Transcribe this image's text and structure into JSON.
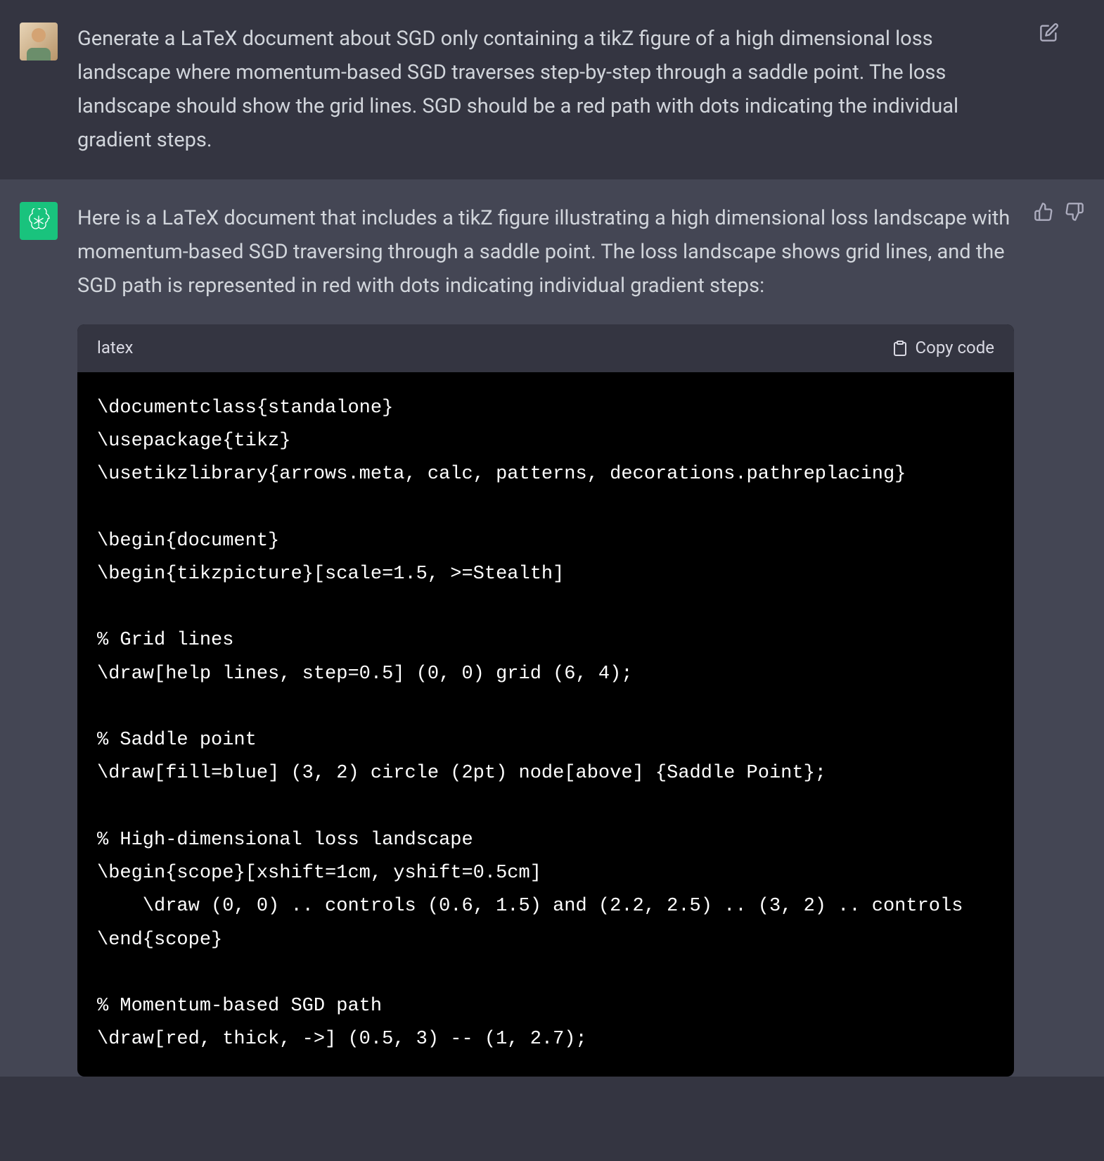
{
  "user_message": {
    "text": "Generate a LaTeX document about SGD only containing a tikZ figure of a high dimensional loss landscape where momentum-based SGD traverses step-by-step through a saddle point. The loss landscape should show the grid lines. SGD should be a red path with dots indicating the individual gradient steps."
  },
  "assistant_message": {
    "intro_text": "Here is a LaTeX document that includes a tikZ figure illustrating a high dimensional loss landscape with momentum-based SGD traversing through a saddle point. The loss landscape shows grid lines, and the SGD path is represented in red with dots indicating individual gradient steps:"
  },
  "code_block": {
    "language": "latex",
    "copy_label": "Copy code",
    "code": "\\documentclass{standalone}\n\\usepackage{tikz}\n\\usetikzlibrary{arrows.meta, calc, patterns, decorations.pathreplacing}\n\n\\begin{document}\n\\begin{tikzpicture}[scale=1.5, >=Stealth]\n\n% Grid lines\n\\draw[help lines, step=0.5] (0, 0) grid (6, 4);\n\n% Saddle point\n\\draw[fill=blue] (3, 2) circle (2pt) node[above] {Saddle Point};\n\n% High-dimensional loss landscape\n\\begin{scope}[xshift=1cm, yshift=0.5cm]\n    \\draw (0, 0) .. controls (0.6, 1.5) and (2.2, 2.5) .. (3, 2) .. controls\n\\end{scope}\n\n% Momentum-based SGD path\n\\draw[red, thick, ->] (0.5, 3) -- (1, 2.7);"
  }
}
